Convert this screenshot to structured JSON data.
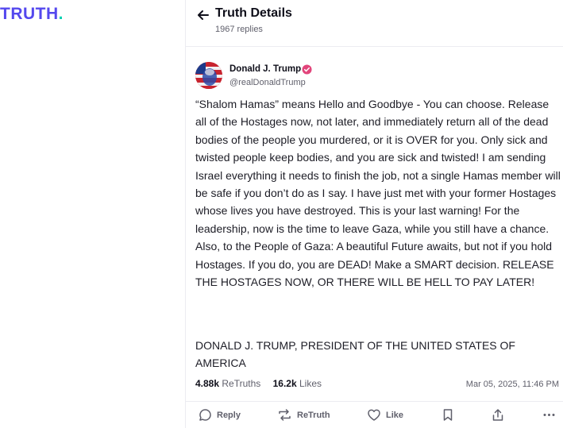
{
  "brand": {
    "logo_text": "TRUTH",
    "logo_dot": ".",
    "color": "#5448ee",
    "dot_color": "#00d1b2"
  },
  "header": {
    "title": "Truth Details",
    "replies": "1967 replies",
    "back_icon": "arrow-left-icon"
  },
  "post": {
    "author": "Donald J. Trump",
    "handle": "@realDonaldTrump",
    "verified_icon": "verified-badge-icon",
    "body": "“Shalom Hamas” means Hello and Goodbye - You can choose. Release all of the Hostages now, not later, and immediately return all of the dead bodies of the people you murdered, or it is OVER for you. Only sick and twisted people keep bodies, and you are sick and twisted! I am sending Israel everything it needs to finish the job, not a single Hamas member will be safe if you don’t do as I say. I have just met with your former Hostages whose lives you have destroyed. This is your last warning! For the leadership, now is the time to leave Gaza, while you still have a chance. Also, to the People of Gaza: A beautiful Future awaits, but not if you hold Hostages. If you do, you are DEAD! Make a SMART decision. RELEASE THE HOSTAGES NOW, OR THERE WILL BE HELL TO PAY LATER!",
    "signature": "DONALD J. TRUMP, PRESIDENT OF THE UNITED STATES OF AMERICA",
    "retruths_count": "4.88k",
    "retruths_label": "ReTruths",
    "likes_count": "16.2k",
    "likes_label": "Likes",
    "timestamp": "Mar 05, 2025, 11:46 PM"
  },
  "actions": {
    "reply": "Reply",
    "retruth": "ReTruth",
    "like": "Like",
    "icons": [
      "reply-icon",
      "retruth-icon",
      "heart-icon",
      "bookmark-icon",
      "share-icon",
      "more-icon"
    ]
  },
  "colors": {
    "accent": "#5448ee",
    "muted": "#5f5f6b",
    "verified": "#e2457b"
  }
}
